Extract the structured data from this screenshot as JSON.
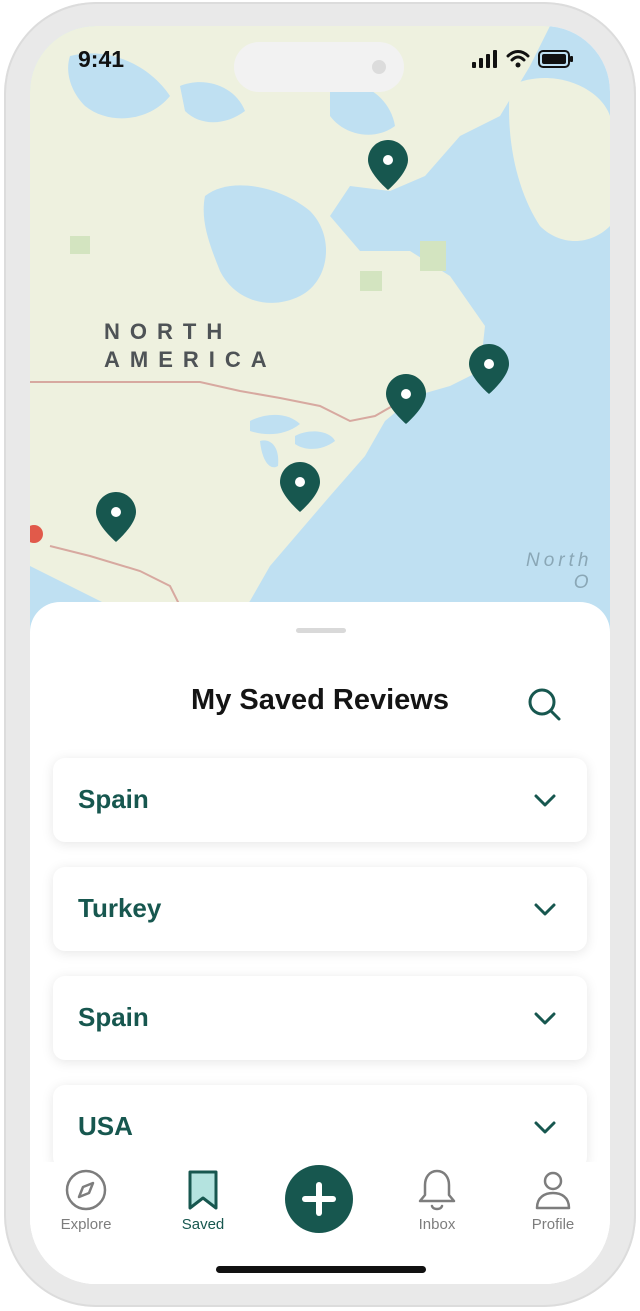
{
  "status_bar": {
    "time": "9:41",
    "icons": [
      "signal-icon",
      "wifi-icon",
      "battery-icon"
    ]
  },
  "map": {
    "continent_label_line1": "NORTH",
    "continent_label_line2": "AMERICA",
    "ocean_label_line1": "North",
    "ocean_label_line2": "O",
    "pins": [
      "map-pin-icon",
      "map-pin-icon",
      "map-pin-icon",
      "map-pin-icon",
      "map-pin-icon"
    ],
    "colors": {
      "water": "#bfe0f2",
      "land": "#eef1df",
      "pin": "#17574f"
    }
  },
  "sheet": {
    "title": "My Saved Reviews",
    "search_icon": "search-icon",
    "items": [
      {
        "label": "Spain",
        "icon": "chevron-down-icon"
      },
      {
        "label": "Turkey",
        "icon": "chevron-down-icon"
      },
      {
        "label": "Spain",
        "icon": "chevron-down-icon"
      },
      {
        "label": "USA",
        "icon": "chevron-down-icon"
      }
    ]
  },
  "tabbar": {
    "tabs": [
      {
        "label": "Explore",
        "icon": "compass-icon",
        "active": false
      },
      {
        "label": "Saved",
        "icon": "bookmark-icon",
        "active": true
      },
      {
        "label": "",
        "icon": "plus-icon",
        "active": false
      },
      {
        "label": "Inbox",
        "icon": "bell-icon",
        "active": false
      },
      {
        "label": "Profile",
        "icon": "user-icon",
        "active": false
      }
    ]
  },
  "colors": {
    "accent": "#17574f",
    "inactive": "#7d7d7d"
  }
}
